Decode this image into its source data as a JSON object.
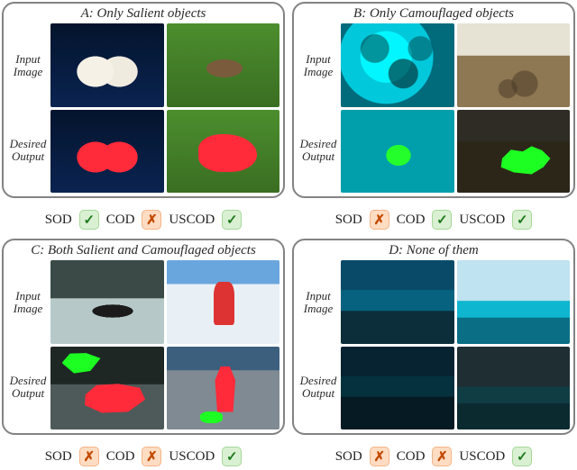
{
  "panels": {
    "a": {
      "title": "A: Only Salient objects",
      "row1": "Input\nImage",
      "row2": "Desired\nOutput",
      "badges": {
        "sod": "ok",
        "cod": "no",
        "uscod": "ok"
      }
    },
    "b": {
      "title": "B: Only Camouflaged objects",
      "row1": "Input\nImage",
      "row2": "Desired\nOutput",
      "badges": {
        "sod": "no",
        "cod": "ok",
        "uscod": "ok"
      }
    },
    "c": {
      "title": "C: Both Salient and Camouflaged objects",
      "row1": "Input\nImage",
      "row2": "Desired\nOutput",
      "badges": {
        "sod": "no",
        "cod": "no",
        "uscod": "ok"
      }
    },
    "d": {
      "title": "D: None of them",
      "row1": "Input\nImage",
      "row2": "Desired\nOutput",
      "badges": {
        "sod": "no",
        "cod": "no",
        "uscod": "ok"
      }
    }
  },
  "labels": {
    "sod": "SOD",
    "cod": "COD",
    "uscod": "USCOD",
    "check": "✓",
    "cross": "✗"
  }
}
